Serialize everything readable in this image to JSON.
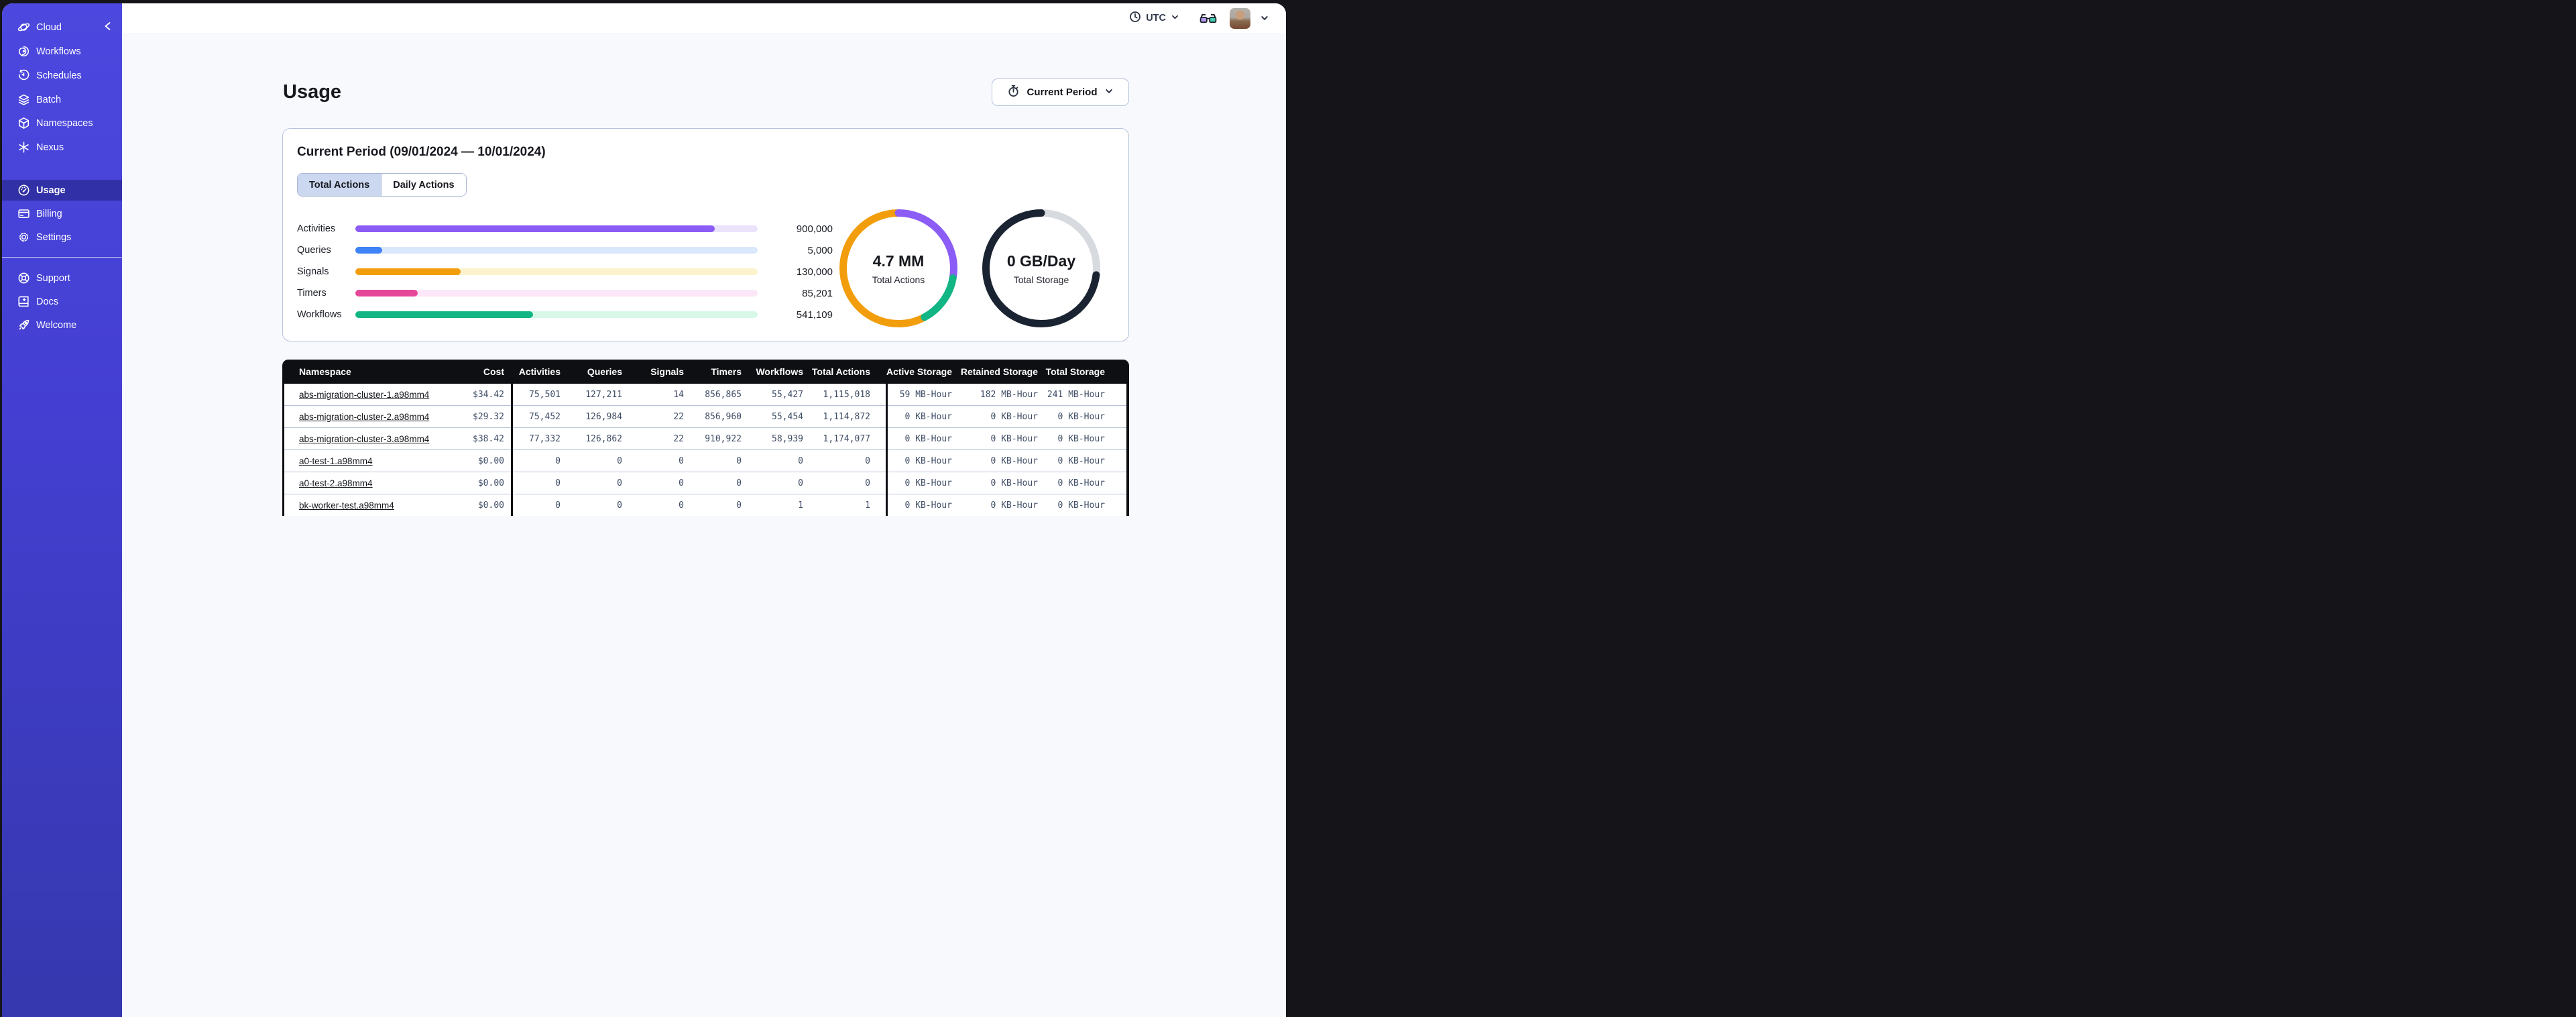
{
  "sidebar": {
    "header": {
      "label": "Cloud"
    },
    "primary": [
      {
        "label": "Workflows",
        "icon": "workflows-icon"
      },
      {
        "label": "Schedules",
        "icon": "schedules-icon"
      },
      {
        "label": "Batch",
        "icon": "batch-icon"
      },
      {
        "label": "Namespaces",
        "icon": "namespaces-icon"
      },
      {
        "label": "Nexus",
        "icon": "nexus-icon"
      }
    ],
    "account": [
      {
        "label": "Usage",
        "icon": "usage-icon",
        "selected": true
      },
      {
        "label": "Billing",
        "icon": "billing-icon",
        "selected": false
      },
      {
        "label": "Settings",
        "icon": "settings-icon",
        "selected": false
      }
    ],
    "footer": [
      {
        "label": "Support",
        "icon": "support-icon"
      },
      {
        "label": "Docs",
        "icon": "docs-icon"
      },
      {
        "label": "Welcome",
        "icon": "welcome-icon"
      }
    ]
  },
  "topbar": {
    "timezone_label": "UTC"
  },
  "page": {
    "title": "Usage",
    "period_button_label": "Current Period"
  },
  "card": {
    "title": "Current Period (09/01/2024 — 10/01/2024)",
    "tabs": [
      {
        "label": "Total Actions",
        "selected": true
      },
      {
        "label": "Daily Actions",
        "selected": false
      }
    ],
    "bars": [
      {
        "label": "Activities",
        "value": "900,000",
        "pct": 0.894,
        "color": "#8B5CF6",
        "track": "#EBE3FC"
      },
      {
        "label": "Queries",
        "value": "5,000",
        "pct": 0.067,
        "color": "#3D82F6",
        "track": "#DBE7FB"
      },
      {
        "label": "Signals",
        "value": "130,000",
        "pct": 0.261,
        "color": "#F29D0C",
        "track": "#FCF2CD"
      },
      {
        "label": "Timers",
        "value": "85,201",
        "pct": 0.155,
        "color": "#E5489B",
        "track": "#FBE7F8"
      },
      {
        "label": "Workflows",
        "value": "541,109",
        "pct": 0.441,
        "color": "#12B584",
        "track": "#D7F8E7"
      }
    ],
    "donuts": [
      {
        "big": "4.7 MM",
        "small": "Total Actions",
        "segments": [
          {
            "color": "#F29D0C",
            "start": 0.422,
            "frac": 0.578
          },
          {
            "color": "#8B5CF6",
            "start": 0.0,
            "frac": 0.278
          },
          {
            "color": "#12B584",
            "start": 0.278,
            "frac": 0.144
          }
        ]
      },
      {
        "big": "0 GB/Day",
        "small": "Total Storage",
        "segments": [
          {
            "color": "#D7DADF",
            "start": 0.0,
            "frac": 1.0
          },
          {
            "color": "#1A2331",
            "start": 0.269,
            "frac": 0.731
          }
        ]
      }
    ]
  },
  "table": {
    "columns": [
      "Namespace",
      "Cost",
      "Activities",
      "Queries",
      "Signals",
      "Timers",
      "Workflows",
      "Total Actions",
      "Active Storage",
      "Retained Storage",
      "Total Storage"
    ],
    "rows": [
      {
        "namespace": "abs-migration-cluster-1.a98mm4",
        "cells": [
          "$34.42",
          "75,501",
          "127,211",
          "14",
          "856,865",
          "55,427",
          "1,115,018",
          "59 MB-Hour",
          "182 MB-Hour",
          "241 MB-Hour"
        ]
      },
      {
        "namespace": "abs-migration-cluster-2.a98mm4",
        "cells": [
          "$29.32",
          "75,452",
          "126,984",
          "22",
          "856,960",
          "55,454",
          "1,114,872",
          "0 KB-Hour",
          "0 KB-Hour",
          "0 KB-Hour"
        ]
      },
      {
        "namespace": "abs-migration-cluster-3.a98mm4",
        "cells": [
          "$38.42",
          "77,332",
          "126,862",
          "22",
          "910,922",
          "58,939",
          "1,174,077",
          "0 KB-Hour",
          "0 KB-Hour",
          "0 KB-Hour"
        ]
      },
      {
        "namespace": "a0-test-1.a98mm4",
        "cells": [
          "$0.00",
          "0",
          "0",
          "0",
          "0",
          "0",
          "0",
          "0 KB-Hour",
          "0 KB-Hour",
          "0 KB-Hour"
        ]
      },
      {
        "namespace": "a0-test-2.a98mm4",
        "cells": [
          "$0.00",
          "0",
          "0",
          "0",
          "0",
          "0",
          "0",
          "0 KB-Hour",
          "0 KB-Hour",
          "0 KB-Hour"
        ]
      },
      {
        "namespace": "bk-worker-test.a98mm4",
        "cells": [
          "$0.00",
          "0",
          "0",
          "0",
          "0",
          "1",
          "1",
          "0 KB-Hour",
          "0 KB-Hour",
          "0 KB-Hour"
        ]
      }
    ]
  },
  "colors": {
    "sidebar_top": "#4C48DF",
    "sidebar_bottom": "#3538AE",
    "table_header_bg": "#0E0F13",
    "content_bg": "#F7F9FC",
    "glasses_left_lens": "#B39AF0",
    "glasses_right_lens": "#43CDB5"
  }
}
